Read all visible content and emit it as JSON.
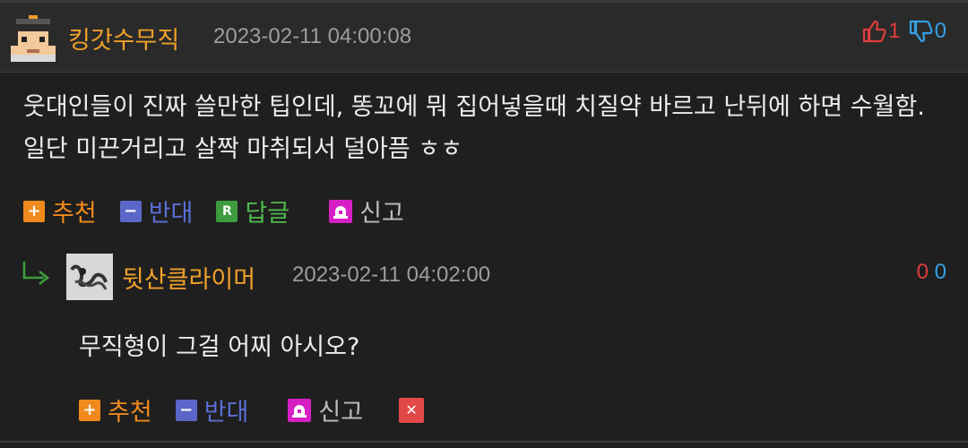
{
  "comment": {
    "username": "킹갓수무직",
    "timestamp": "2023-02-11 04:00:08",
    "upvotes": "1",
    "downvotes": "0",
    "body": "웃대인들이 진짜 쓸만한 팁인데, 똥꼬에 뭐 집어넣을때 치질약 바르고 난뒤에 하면 수월함. 일단 미끈거리고 살짝 마취되서 덜아픔 ㅎㅎ",
    "actions": {
      "upvote_label": "추천",
      "downvote_label": "반대",
      "reply_label": "답글",
      "report_label": "신고"
    }
  },
  "reply": {
    "username": "뒷산클라이머",
    "timestamp": "2023-02-11 04:02:00",
    "upvotes": "0",
    "downvotes": "0",
    "body": "무직형이 그걸 어찌 아시오?",
    "actions": {
      "upvote_label": "추천",
      "downvote_label": "반대",
      "report_label": "신고"
    }
  },
  "colors": {
    "background": "#1f1f1f",
    "header": "#2a2a2a",
    "username": "#f0a12a",
    "upvote": "#e03c3c",
    "downvote": "#35a0e6",
    "recommend": "#f08a1c",
    "oppose": "#5b67c8",
    "reply": "#3d9c3d",
    "report": "#d61fc5",
    "delete": "#e24848"
  },
  "icons": {
    "avatar_main": "pixel-avatar-icon",
    "avatar_reply": "scribble-avatar-icon",
    "thumb_up": "thumbs-up-icon",
    "thumb_down": "thumbs-down-icon",
    "plus": "plus-icon",
    "minus": "minus-icon",
    "reply": "reply-r-icon",
    "report": "siren-icon",
    "reply_arrow": "reply-arrow-icon",
    "delete": "close-icon"
  }
}
